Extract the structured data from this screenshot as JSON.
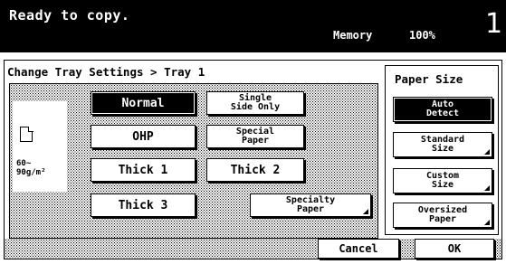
{
  "header": {
    "status": "Ready to copy.",
    "memory_label": "Memory",
    "memory_value": "100%",
    "copies": "1"
  },
  "breadcrumb": "Change Tray Settings > Tray 1",
  "paper_info": {
    "icon": "page-icon",
    "weight": [
      "60~",
      "90g/m²"
    ]
  },
  "paper_types": [
    {
      "label": "Normal",
      "selected": true
    },
    {
      "lines": [
        "Single",
        "Side Only"
      ]
    },
    {
      "label": "OHP"
    },
    {
      "lines": [
        "Special",
        "Paper"
      ]
    },
    {
      "label": "Thick 1"
    },
    {
      "label": "Thick 2"
    },
    {
      "label": "Thick 3"
    },
    {
      "lines": [
        "Specialty",
        "Paper"
      ]
    }
  ],
  "paper_size": {
    "title": "Paper Size",
    "options": [
      {
        "lines": [
          "Auto",
          "Detect"
        ],
        "selected": true
      },
      {
        "lines": [
          "Standard",
          "Size"
        ]
      },
      {
        "lines": [
          "Custom",
          "Size"
        ]
      },
      {
        "lines": [
          "Oversized",
          "Paper"
        ]
      }
    ]
  },
  "actions": {
    "cancel": "Cancel",
    "ok": "OK"
  }
}
